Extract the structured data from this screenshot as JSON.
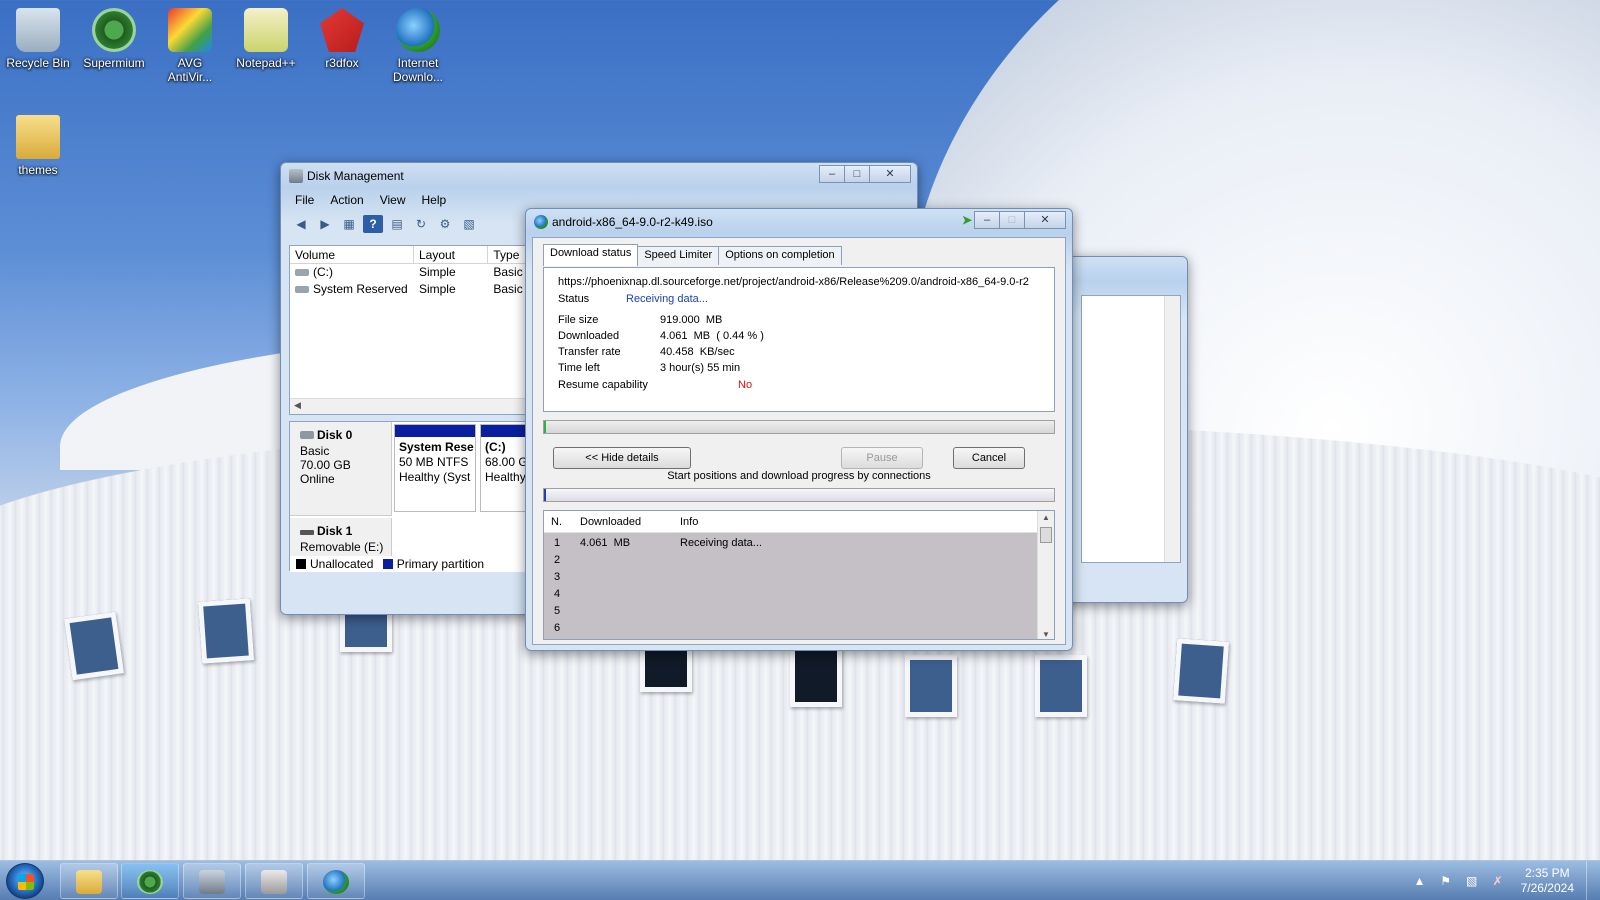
{
  "desktop": {
    "icons": [
      {
        "label": "Recycle Bin",
        "icon": "recycle-bin-icon"
      },
      {
        "label": "Supermium",
        "icon": "supermium-icon"
      },
      {
        "label": "AVG AntiVir...",
        "icon": "avg-icon"
      },
      {
        "label": "Notepad++",
        "icon": "notepadpp-icon"
      },
      {
        "label": "r3dfox",
        "icon": "r3dfox-icon"
      },
      {
        "label": "Internet Downlo...",
        "icon": "idm-icon"
      },
      {
        "label": "themes",
        "icon": "folder-icon"
      }
    ]
  },
  "disk_management": {
    "title": "Disk Management",
    "menu": [
      "File",
      "Action",
      "View",
      "Help"
    ],
    "volume_columns": [
      "Volume",
      "Layout",
      "Type"
    ],
    "volumes": [
      {
        "volume": "(C:)",
        "layout": "Simple",
        "type": "Basic"
      },
      {
        "volume": "System Reserved",
        "layout": "Simple",
        "type": "Basic"
      }
    ],
    "disk0": {
      "name": "Disk 0",
      "type": "Basic",
      "size": "70.00 GB",
      "state": "Online",
      "part1": {
        "name": "System Rese",
        "info": "50 MB NTFS",
        "health": "Healthy (Syst"
      },
      "part2": {
        "name": "(C:)",
        "info": "68.00 G",
        "health": "Healthy"
      }
    },
    "disk1": {
      "name": "Disk 1",
      "type": "Removable (E:)"
    },
    "legend": {
      "unallocated": "Unallocated",
      "primary": "Primary partition"
    }
  },
  "idm": {
    "title": "android-x86_64-9.0-r2-k49.iso",
    "tabs": [
      "Download status",
      "Speed Limiter",
      "Options on completion"
    ],
    "url": "https://phoenixnap.dl.sourceforge.net/project/android-x86/Release%209.0/android-x86_64-9.0-r2",
    "status_label": "Status",
    "status_value": "Receiving data...",
    "fields": [
      {
        "label": "File size",
        "value": "919.000  MB"
      },
      {
        "label": "Downloaded",
        "value": "4.061  MB  ( 0.44 % )"
      },
      {
        "label": "Transfer rate",
        "value": "40.458  KB/sec"
      },
      {
        "label": "Time left",
        "value": "3 hour(s) 55 min"
      }
    ],
    "resume_label": "Resume capability",
    "resume_value": "No",
    "progress_fraction": 0.0044,
    "buttons": {
      "hide_details": "<< Hide details",
      "pause": "Pause",
      "cancel": "Cancel"
    },
    "connections_caption": "Start positions and download progress by connections",
    "conn_columns": [
      "N.",
      "Downloaded",
      "Info"
    ],
    "connections": [
      {
        "n": "1",
        "downloaded": "4.061  MB",
        "info": "Receiving data..."
      },
      {
        "n": "2",
        "downloaded": "",
        "info": ""
      },
      {
        "n": "3",
        "downloaded": "",
        "info": ""
      },
      {
        "n": "4",
        "downloaded": "",
        "info": ""
      },
      {
        "n": "5",
        "downloaded": "",
        "info": ""
      },
      {
        "n": "6",
        "downloaded": "",
        "info": ""
      }
    ],
    "status_color": "#1a3fb0",
    "resume_color": "#e01010"
  },
  "taskbar": {
    "time": "2:35 PM",
    "date": "7/26/2024",
    "items": [
      "explorer-icon",
      "supermium-icon",
      "disk-management-icon",
      "printer-icon",
      "idm-icon"
    ]
  }
}
